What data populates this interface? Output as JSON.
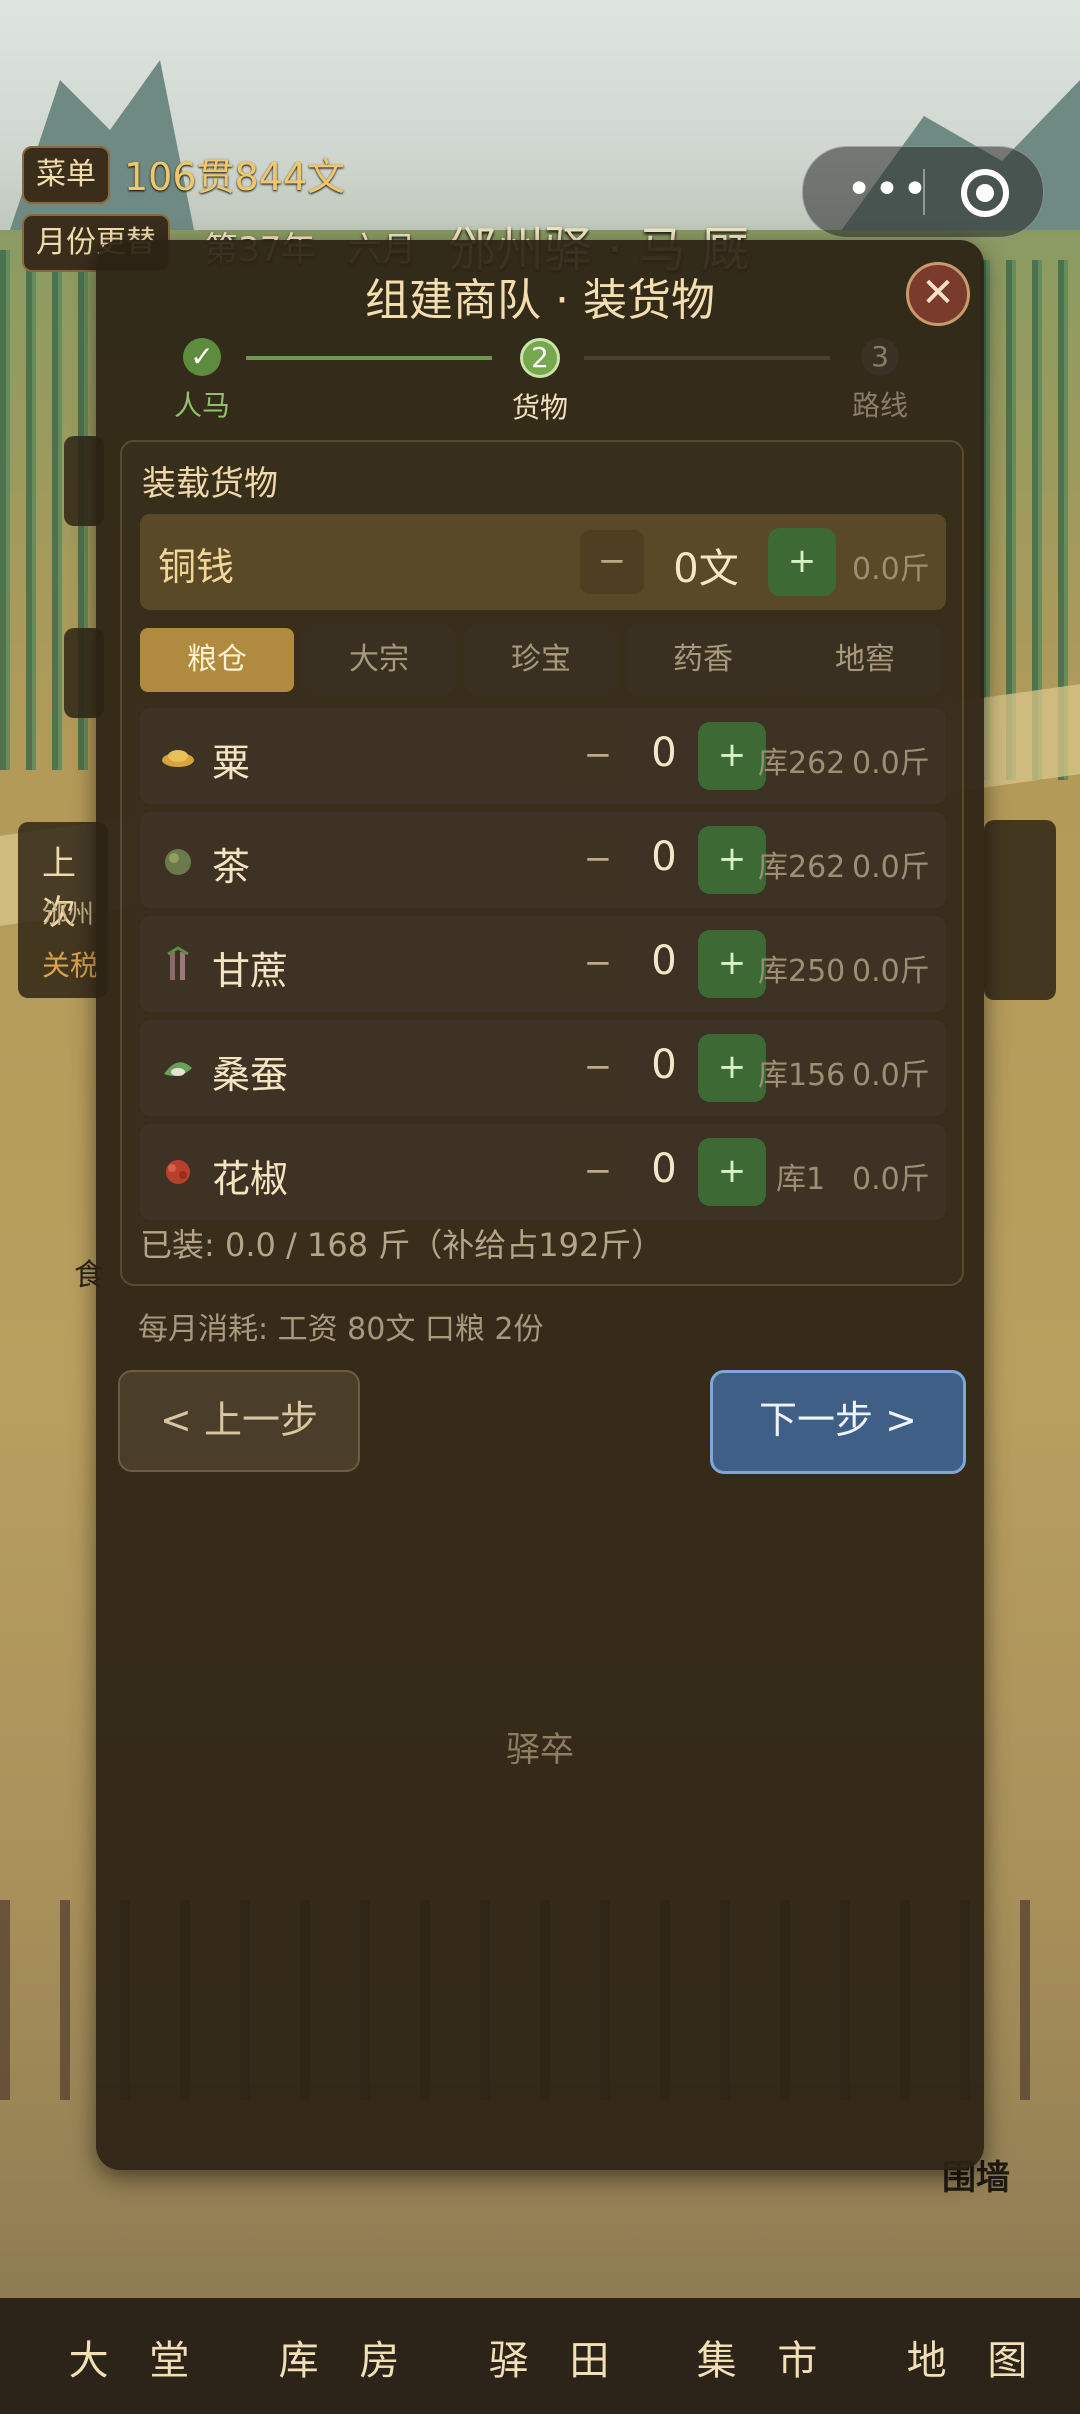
{
  "hud": {
    "menu_label": "菜单",
    "money": "106贯844文",
    "month_label": "月份更替",
    "year_text": "第37年",
    "month_text": "六月",
    "location": "邠州驿 · 马 厩"
  },
  "scene": {
    "label_wall": "围墙",
    "label_soldier": "驿卒",
    "label_food": "食",
    "side_card": {
      "title": "上次",
      "line1": "邠州",
      "line2": "关税"
    }
  },
  "modal": {
    "title": "组建商队 · 装货物",
    "close": "✕",
    "steps": [
      {
        "num": "✓",
        "label": "人马",
        "state": "done"
      },
      {
        "num": "2",
        "label": "货物",
        "state": "current"
      },
      {
        "num": "3",
        "label": "路线",
        "state": "next"
      }
    ],
    "panel_title": "装载货物",
    "coin": {
      "name": "铜钱",
      "minus": "−",
      "qty": "0文",
      "plus": "+",
      "weight": "0.0斤"
    },
    "tabs": [
      {
        "label": "粮仓",
        "active": true
      },
      {
        "label": "大宗",
        "active": false
      },
      {
        "label": "珍宝",
        "active": false
      },
      {
        "label": "药香",
        "active": false
      },
      {
        "label": "地窖",
        "active": false
      }
    ],
    "items": [
      {
        "name": "粟",
        "qty": "0",
        "stock": "库262",
        "weight": "0.0斤",
        "icon": "millet-icon"
      },
      {
        "name": "茶",
        "qty": "0",
        "stock": "库262",
        "weight": "0.0斤",
        "icon": "tea-icon"
      },
      {
        "name": "甘蔗",
        "qty": "0",
        "stock": "库250",
        "weight": "0.0斤",
        "icon": "sugarcane-icon"
      },
      {
        "name": "桑蚕",
        "qty": "0",
        "stock": "库156",
        "weight": "0.0斤",
        "icon": "silkworm-icon"
      },
      {
        "name": "花椒",
        "qty": "0",
        "stock": "库1",
        "weight": "0.0斤",
        "icon": "pepper-icon"
      }
    ],
    "minus_label": "−",
    "plus_label": "+",
    "loaded": "已装: 0.0 / 168 斤（补给占192斤）",
    "monthly": "每月消耗: 工资 80文  口粮 2份",
    "prev": "< 上一步",
    "next": "下一步 >"
  },
  "nav": [
    "大 堂",
    "库 房",
    "驿 田",
    "集 市",
    "地 图"
  ]
}
